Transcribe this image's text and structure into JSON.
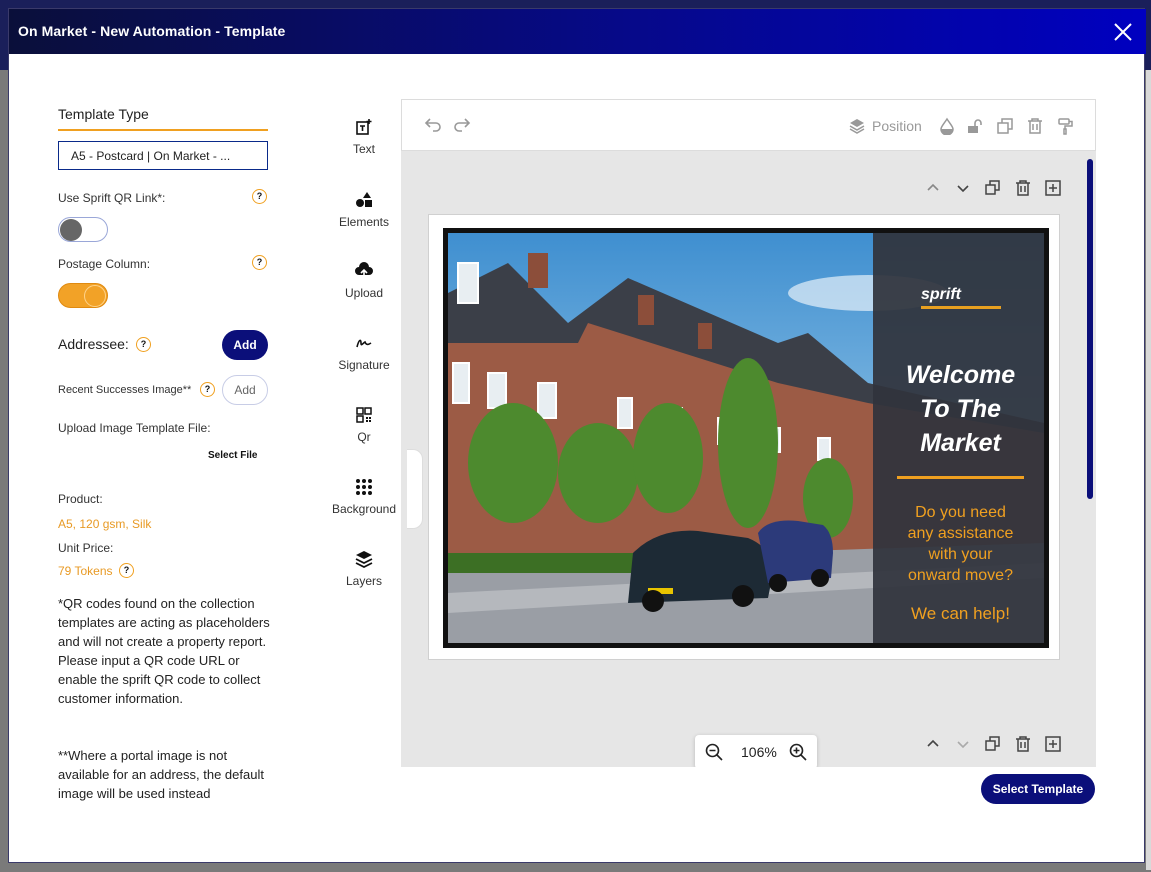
{
  "modal": {
    "title": "On Market - New Automation - Template",
    "close_icon": "close-icon"
  },
  "left_panel": {
    "template_type_title": "Template Type",
    "template_select_value": "A5 - Postcard | On Market - ...",
    "qr_link_label": "Use Sprift QR Link*:",
    "qr_link_enabled": false,
    "postage_label": "Postage Column:",
    "postage_enabled": true,
    "help_glyph": "?",
    "addressee_label": "Addressee:",
    "addressee_add": "Add",
    "recent_successes_label": "Recent Successes Image**",
    "recent_add": "Add",
    "upload_label": "Upload Image Template File:",
    "select_file": "Select File",
    "product_label": "Product:",
    "product_value": "A5, 120 gsm, Silk",
    "unit_price_label": "Unit Price:",
    "unit_price_value": "79 Tokens",
    "note1": "*QR codes found on the collection templates are acting as placeholders and will not create a property report. Please input a QR code URL or enable the sprift QR code to collect customer information.",
    "note2": "**Where a portal image is not available for an address, the default image will be used instead"
  },
  "tools": [
    {
      "label": "Text",
      "icon": "text-add-icon"
    },
    {
      "label": "Elements",
      "icon": "shapes-icon"
    },
    {
      "label": "Upload",
      "icon": "cloud-upload-icon"
    },
    {
      "label": "Signature",
      "icon": "signature-icon"
    },
    {
      "label": "Qr",
      "icon": "qr-code-icon"
    },
    {
      "label": "Background",
      "icon": "dots-grid-icon"
    },
    {
      "label": "Layers",
      "icon": "layers-icon"
    }
  ],
  "toolbar": {
    "position_label": "Position"
  },
  "card": {
    "logo": "sprift",
    "headline": [
      "Welcome",
      "To The",
      "Market"
    ],
    "assist_lines": [
      "Do you need",
      "any assistance",
      "with your",
      "onward move?"
    ],
    "help_line": "We can help!",
    "colors": {
      "accent": "#f0a020",
      "overlay": "#30343c",
      "navy": "#0b0f7a"
    }
  },
  "zoom": {
    "value": "106%"
  },
  "footer": {
    "select_template": "Select Template"
  }
}
